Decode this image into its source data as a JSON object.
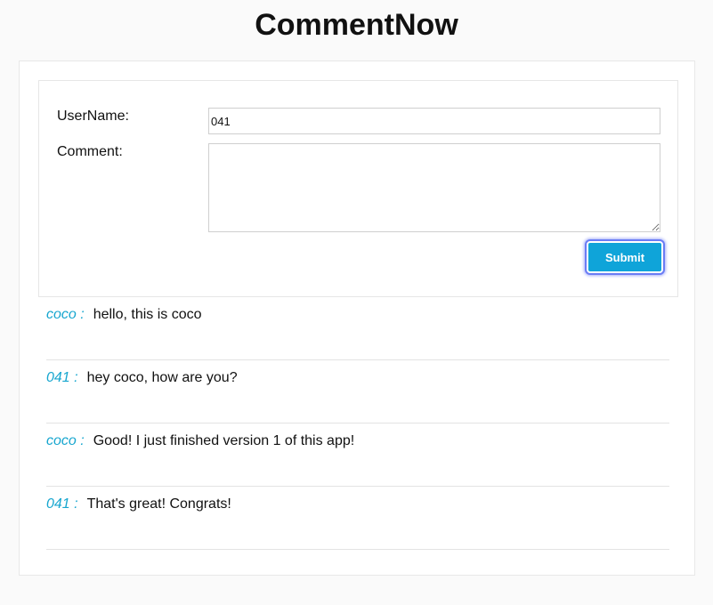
{
  "app": {
    "title": "CommentNow"
  },
  "form": {
    "username_label": "UserName:",
    "comment_label": "Comment:",
    "username_value": "041",
    "comment_value": "",
    "submit_label": "Submit"
  },
  "comments": [
    {
      "user": "coco :",
      "text": "hello, this is coco"
    },
    {
      "user": "041 :",
      "text": "hey coco, how are you?"
    },
    {
      "user": "coco :",
      "text": "Good! I just finished version 1 of this app!"
    },
    {
      "user": "041 :",
      "text": "That's great! Congrats!"
    }
  ],
  "colors": {
    "accent": "#0fa4d9",
    "username_color": "#17a6cf",
    "focus_ring": "#6a7cf5"
  }
}
